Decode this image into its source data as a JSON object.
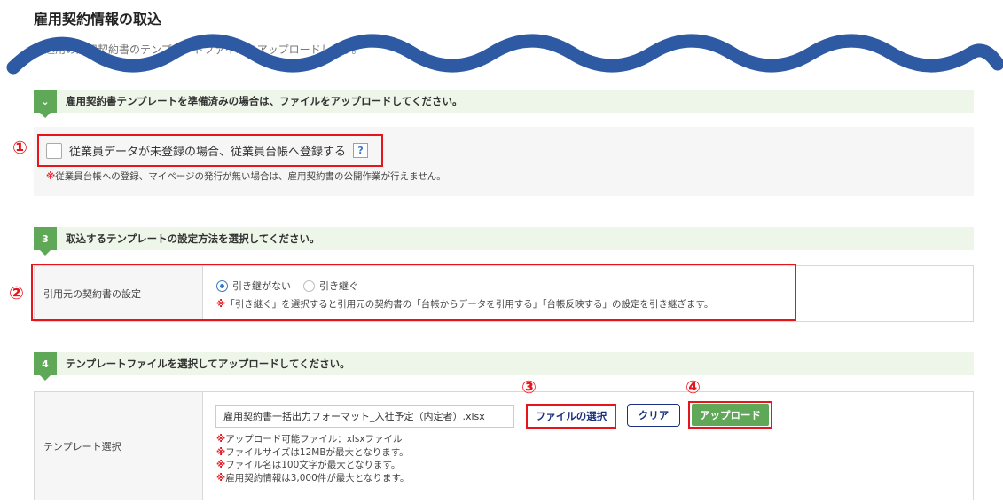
{
  "header": {
    "title": "雇用契約情報の取込",
    "subtitle": "取込用の雇用契約書のテンプレートファイルをアップロードします。"
  },
  "step1": {
    "text": "雇用契約書テンプレートを準備済みの場合は、ファイルをアップロードしてください。",
    "checkbox_label": "従業員データが未登録の場合、従業員台帳へ登録する",
    "checkbox_checked": false,
    "help_label": "?",
    "note": "従業員台帳への登録、マイページの発行が無い場合は、雇用契約書の公開作業が行えません。"
  },
  "step3": {
    "num": "3",
    "text": "取込するテンプレートの設定方法を選択してください。",
    "row_label": "引用元の契約書の設定",
    "options": [
      "引き継がない",
      "引き継ぐ"
    ],
    "selected": "引き継がない",
    "note": "「引き継ぐ」を選択すると引用元の契約書の「台帳からデータを引用する」「台帳反映する」の設定を引き継ぎます。"
  },
  "step4": {
    "num": "4",
    "text": "テンプレートファイルを選択してアップロードしてください。",
    "row_label": "テンプレート選択",
    "file_value": "雇用契約書一括出力フォーマット_入社予定（内定者）.xlsx",
    "select_button": "ファイルの選択",
    "clear_button": "クリア",
    "upload_button": "アップロード",
    "notes": [
      "アップロード可能ファイル：xlsxファイル",
      "ファイルサイズは12MBが最大となります。",
      "ファイル名は100文字が最大となります。",
      "雇用契約情報は3,000件が最大となります。"
    ]
  },
  "markers": [
    "①",
    "②",
    "③",
    "④"
  ],
  "note_mark": "※",
  "colors": {
    "accent_green": "#5fa857",
    "highlight_red": "#e8141b",
    "wave_blue": "#2d5aa3",
    "navy": "#1a2f80"
  }
}
